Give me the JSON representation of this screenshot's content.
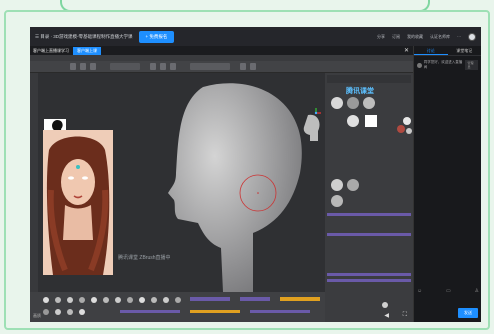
{
  "header": {
    "course_title": "☰ 目录 · 3D游戏建模-零基础课程制作直播大学课",
    "cta_label": "+ 免费报名",
    "actions": [
      "分享",
      "订阅",
      "我的收藏",
      "认证名师库",
      "···"
    ]
  },
  "player": {
    "chip_label": "客户端上直播课学习",
    "chip_button": "客户端上课",
    "watermark": "腾讯课堂 ZBrush直播中",
    "brand": "腾讯课堂",
    "bottom_left_label": "画质"
  },
  "chat": {
    "tabs": [
      "讨论",
      "课堂笔记"
    ],
    "active_tab": 0,
    "first_message": "同学您好，欢迎进入直播间",
    "tag": "管理员",
    "send_label": "发送"
  },
  "colors": {
    "accent": "#1e8fff",
    "window_bg": "#1f2024",
    "frame": "#9ee0b5"
  }
}
